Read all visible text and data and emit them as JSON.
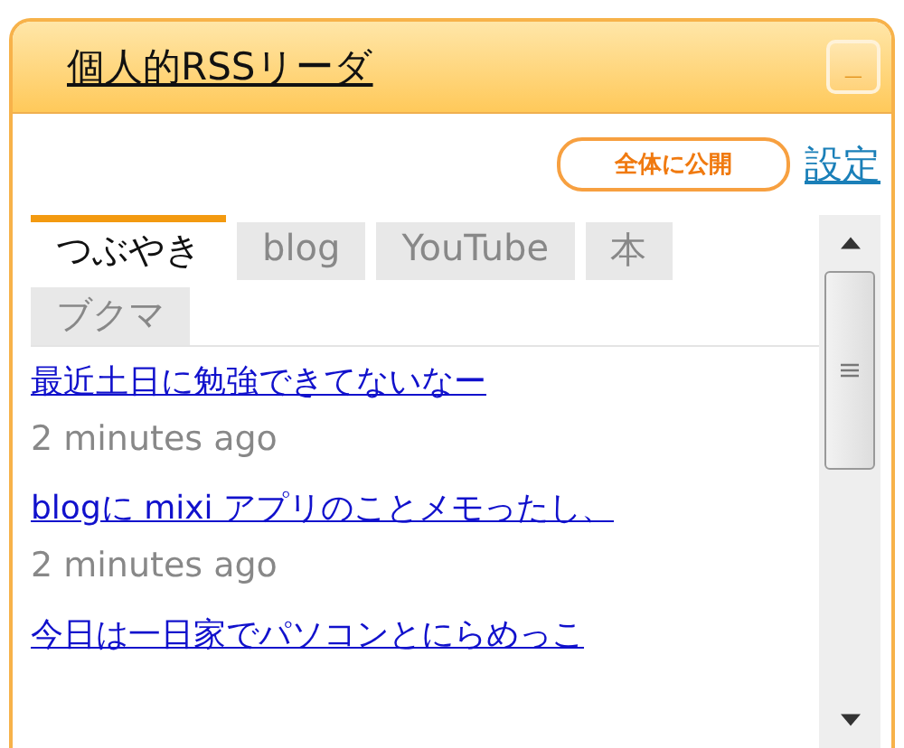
{
  "widget": {
    "title": "個人的RSSリーダ",
    "minimize_label": "_"
  },
  "toolbar": {
    "publish_button": "全体に公開",
    "settings_link": "設定"
  },
  "tabs": [
    {
      "label": "つぶやき",
      "selected": true
    },
    {
      "label": "blog",
      "selected": false
    },
    {
      "label": "YouTube",
      "selected": false
    },
    {
      "label": "本",
      "selected": false
    },
    {
      "label": "ブクマ",
      "selected": false
    }
  ],
  "entries": [
    {
      "title": "最近土日に勉強できてないなー",
      "time": "2 minutes ago"
    },
    {
      "title": "blogに mixi アプリのことメモったし、",
      "time": "2 minutes ago"
    },
    {
      "title": "今日は一日家でパソコンとにらめっこ"
    }
  ]
}
